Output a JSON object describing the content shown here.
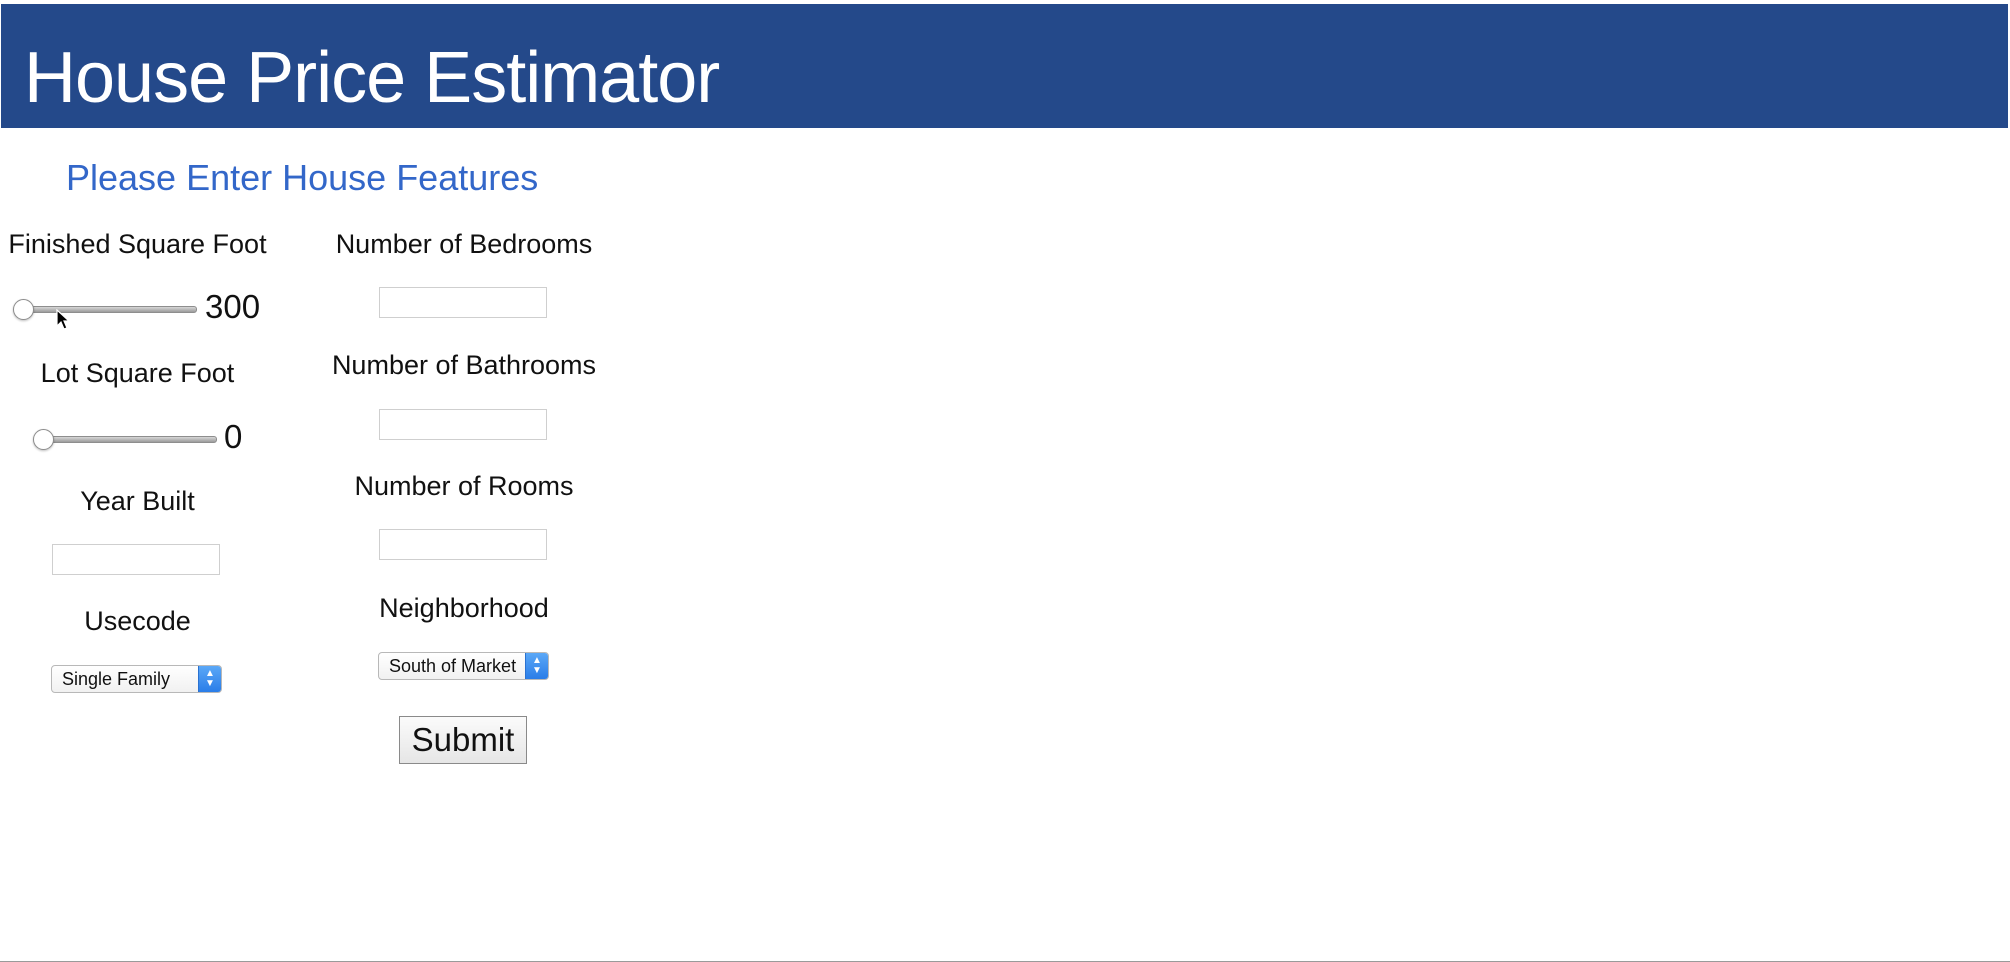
{
  "header": {
    "title": "House Price Estimator",
    "background_color": "#24498a"
  },
  "form": {
    "section_title": "Please Enter House Features",
    "section_title_color": "#3367c9",
    "finished_sqft": {
      "label": "Finished Square Foot",
      "value": "300",
      "slider_position": 0
    },
    "lot_sqft": {
      "label": "Lot Square Foot",
      "value": "0",
      "slider_position": 0
    },
    "year_built": {
      "label": "Year Built",
      "value": ""
    },
    "usecode": {
      "label": "Usecode",
      "selected": "Single Family"
    },
    "bedrooms": {
      "label": "Number of Bedrooms",
      "value": ""
    },
    "bathrooms": {
      "label": "Number of Bathrooms",
      "value": ""
    },
    "rooms": {
      "label": "Number of Rooms",
      "value": ""
    },
    "neighborhood": {
      "label": "Neighborhood",
      "selected": "South of Market"
    },
    "submit_label": "Submit"
  },
  "icons": {
    "cursor": "arrow-cursor-icon",
    "select_arrows": "chevron-up-down-icon"
  }
}
